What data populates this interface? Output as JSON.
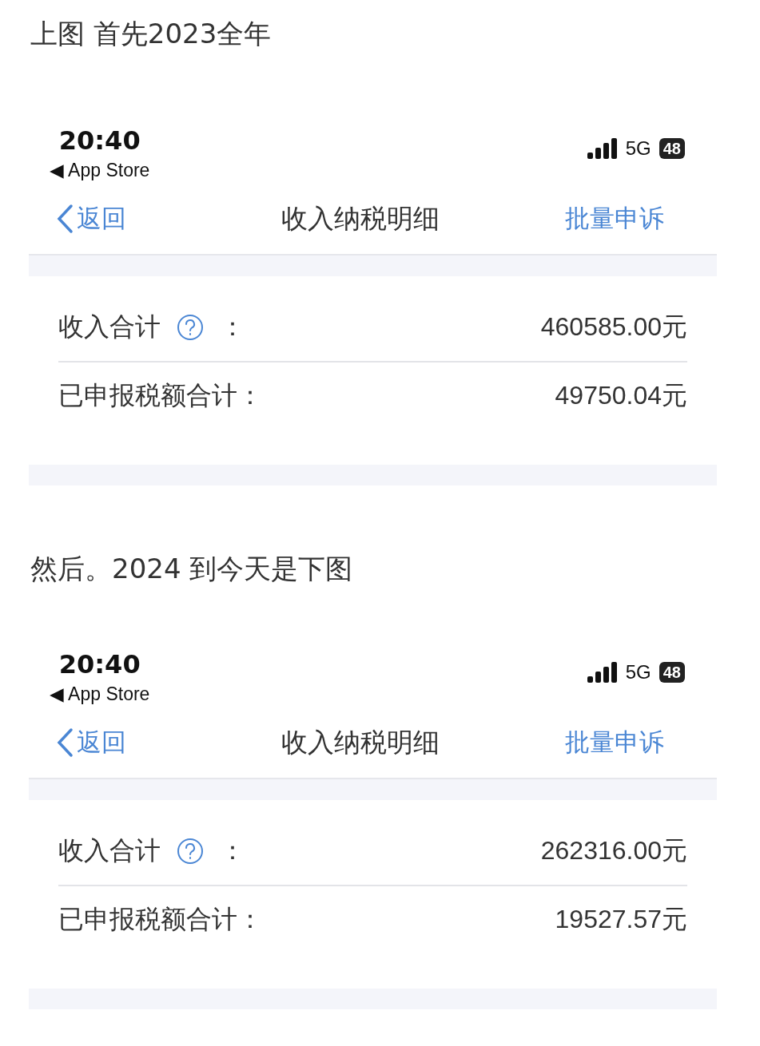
{
  "sections": [
    {
      "caption": "上图 首先2023全年",
      "screenshot": {
        "status_bar": {
          "time": "20:40",
          "back_app": "◀ App Store",
          "network": "5G",
          "battery": "48"
        },
        "nav": {
          "back": "返回",
          "title": "收入纳税明细",
          "action": "批量申诉"
        },
        "rows": [
          {
            "label": "收入合计",
            "help": true,
            "colon": "：",
            "value": "460585.00元"
          },
          {
            "label": "已申报税额合计：",
            "help": false,
            "value": "49750.04元"
          }
        ]
      }
    },
    {
      "caption": "然后。2024 到今天是下图",
      "screenshot": {
        "status_bar": {
          "time": "20:40",
          "back_app": "◀ App Store",
          "network": "5G",
          "battery": "48"
        },
        "nav": {
          "back": "返回",
          "title": "收入纳税明细",
          "action": "批量申诉"
        },
        "rows": [
          {
            "label": "收入合计",
            "help": true,
            "colon": "：",
            "value": "262316.00元"
          },
          {
            "label": "已申报税额合计：",
            "help": false,
            "value": "19527.57元"
          }
        ]
      }
    }
  ]
}
